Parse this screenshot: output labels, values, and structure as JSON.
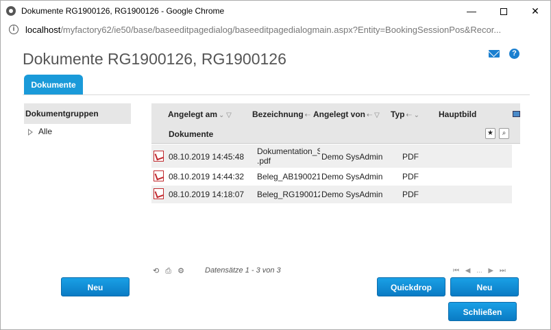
{
  "window": {
    "title": "Dokumente RG1900126, RG1900126 - Google Chrome",
    "min_glyph": "—",
    "close_glyph": "✕"
  },
  "address": {
    "host": "localhost",
    "path": "/myfactory62/ie50/base/baseeditpagedialog/baseeditpagedialogmain.aspx?Entity=BookingSessionPos&Recor..."
  },
  "page": {
    "title": "Dokumente RG1900126, RG1900126",
    "help_glyph": "?"
  },
  "tabs": [
    {
      "label": "Dokumente",
      "active": true
    }
  ],
  "sidebar": {
    "header": "Dokumentgruppen",
    "items": [
      {
        "label": "Alle"
      }
    ]
  },
  "grid": {
    "columns": {
      "created": "Angelegt am",
      "name": "Bezeichnung",
      "creator": "Angelegt von",
      "type": "Typ",
      "main_image": "Hauptbild",
      "documents": "Dokumente"
    },
    "rows": [
      {
        "created": "08.10.2019 14:45:48",
        "name": "Dokumentation_S",
        "name_line2": ".pdf",
        "creator": "Demo SysAdmin",
        "type": "PDF"
      },
      {
        "created": "08.10.2019 14:44:32",
        "name": "Beleg_AB190021",
        "creator": "Demo SysAdmin",
        "type": "PDF"
      },
      {
        "created": "08.10.2019 14:18:07",
        "name": "Beleg_RG190012",
        "creator": "Demo SysAdmin",
        "type": "PDF"
      }
    ],
    "records_text": "Datensätze 1 - 3 von 3",
    "pager_ellipsis": "..."
  },
  "buttons": {
    "neu_left": "Neu",
    "quickdrop": "Quickdrop",
    "neu_right": "Neu",
    "close": "Schließen"
  },
  "colors": {
    "accent": "#1a9ad9",
    "button": "#0a7bc4",
    "header_bg": "#e6e6e6",
    "pdf_red": "#c0282d"
  }
}
